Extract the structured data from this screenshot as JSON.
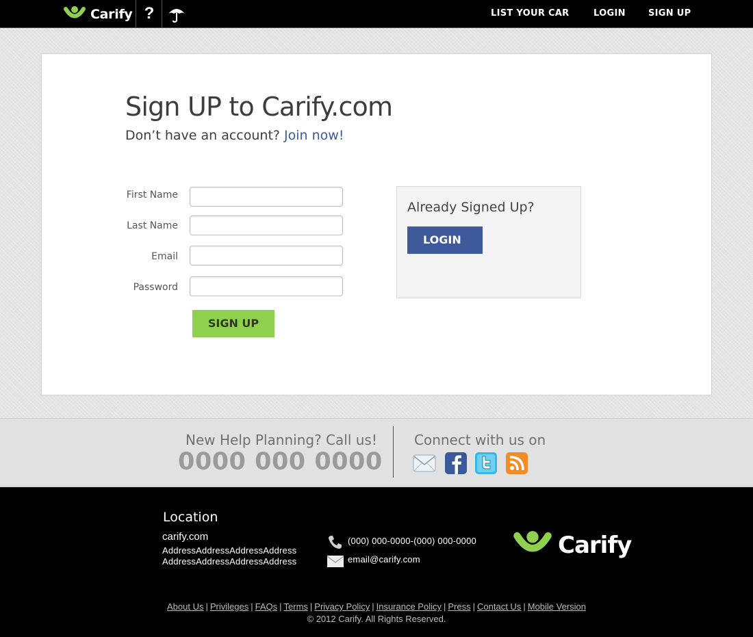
{
  "brand": {
    "name": "Carify",
    "primary_color": "#8fd14f",
    "secondary_color": "#3e5a9b"
  },
  "nav": {
    "help_label": "?",
    "links": [
      "LIST YOUR CAR",
      "LOGIN",
      "SIGN UP"
    ]
  },
  "signup": {
    "title": "Sign UP to Carify.com",
    "subtitle": "Don’t have an account?",
    "join_link": "Join now!",
    "fields": [
      {
        "label": "First Name",
        "value": ""
      },
      {
        "label": "Last Name",
        "value": ""
      },
      {
        "label": "Email",
        "value": ""
      },
      {
        "label": "Password",
        "value": ""
      }
    ],
    "submit_label": "SIGN UP"
  },
  "login_panel": {
    "title": "Already Signed Up?",
    "button_label": "LOGIN"
  },
  "help": {
    "title": "New Help Planning? Call us!",
    "phone": "0000 000 0000"
  },
  "connect": {
    "title": "Connect with us on",
    "icons": [
      "email-icon",
      "facebook-icon",
      "twitter-icon",
      "rss-icon"
    ]
  },
  "footer": {
    "location_title": "Location",
    "site": "carify.com",
    "address_lines": [
      "AddressAddressAddressAddress",
      "AddressAddressAddressAddress"
    ],
    "phone": "(000) 000-0000-(000) 000-0000",
    "email": "email@carify.com",
    "links": [
      "About Us",
      "Privileges",
      "FAQs",
      "Terms",
      "Privacy Policy",
      "Insurance Policy",
      "Press",
      "Contact Us",
      "Mobile Version"
    ],
    "copyright": "© 2012 Carify. All Rights Reserved."
  }
}
